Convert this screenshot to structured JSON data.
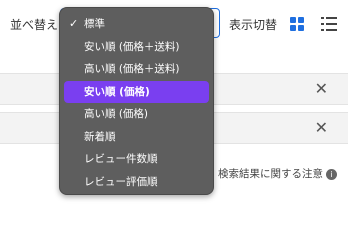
{
  "toolbar": {
    "sort_label": "並べ替え",
    "view_label": "表示切替"
  },
  "dropdown": {
    "items": [
      {
        "label": "標準",
        "checked": true
      },
      {
        "label": "安い順 (価格＋送料)"
      },
      {
        "label": "高い順 (価格＋送料)"
      },
      {
        "label": "安い順 (価格)",
        "selected": true
      },
      {
        "label": "高い順 (価格)"
      },
      {
        "label": "新着順"
      },
      {
        "label": "レビュー件数順"
      },
      {
        "label": "レビュー評価順"
      }
    ],
    "check_glyph": "✓"
  },
  "rows": {
    "close_glyph": "✕"
  },
  "notice": {
    "text": "検索結果に関する注意",
    "info_glyph": "i"
  },
  "colors": {
    "accent": "#1f6fe0",
    "selected": "#7a3ff0",
    "menu_bg": "#5e5e5e"
  }
}
